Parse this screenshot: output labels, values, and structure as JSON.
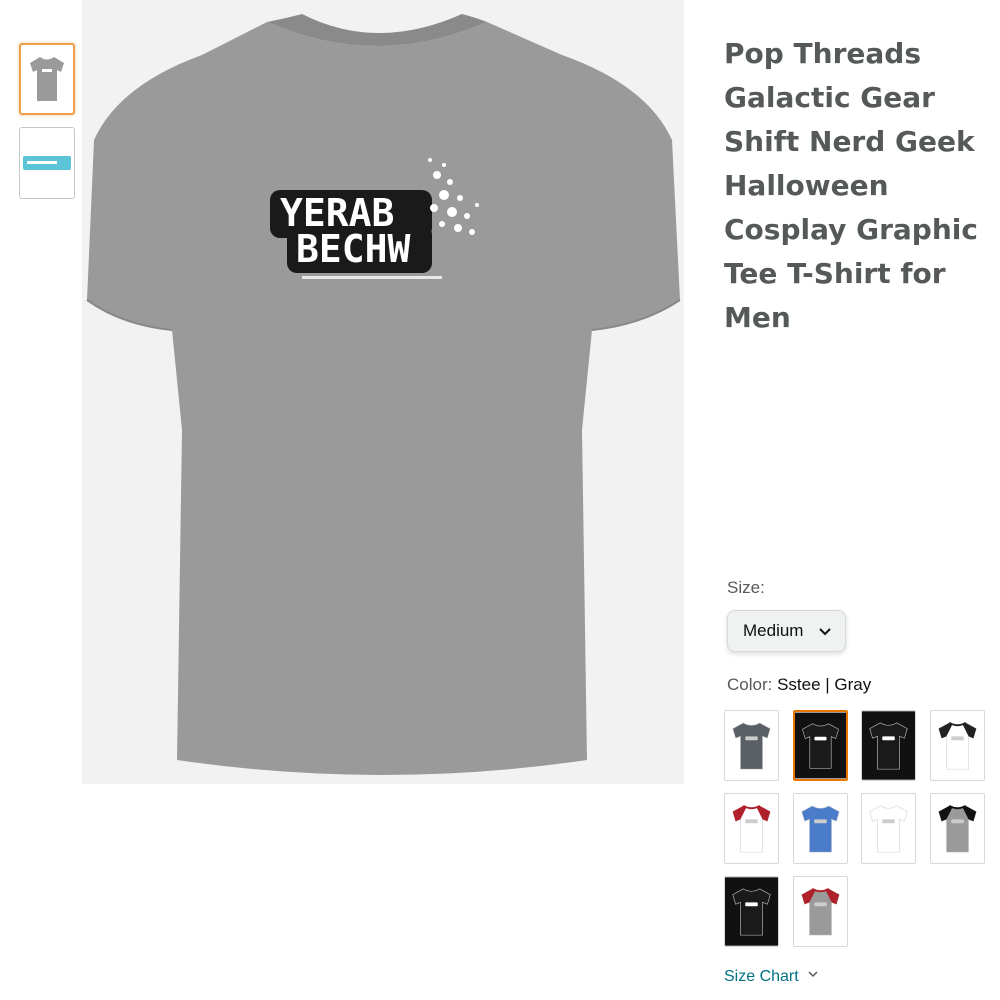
{
  "product": {
    "title": "Pop Threads Galactic Gear Shift Nerd Geek Halloween Cosplay Graphic Tee T-Shirt for Men",
    "print_text_line1": "YERAB",
    "print_text_line2": "BECHW",
    "shirt_color": "#9a9a9a"
  },
  "thumbnails": [
    {
      "name": "gray-shirt-thumbnail",
      "selected": true
    },
    {
      "name": "size-chart-thumbnail",
      "selected": false
    }
  ],
  "size": {
    "label": "Size:",
    "selected": "Medium"
  },
  "color": {
    "label": "Color:",
    "selected": "Sstee | Gray"
  },
  "swatches": [
    {
      "body": "#5b5f66",
      "trim": "#5b5f66",
      "bg": "#ffffff",
      "selected": false
    },
    {
      "body": "#1a1a1a",
      "trim": "#1a1a1a",
      "bg": "#111111",
      "selected": true
    },
    {
      "body": "#1a1a1a",
      "trim": "#1a1a1a",
      "bg": "#111111",
      "selected": false
    },
    {
      "body": "#ffffff",
      "trim": "#222222",
      "bg": "#ffffff",
      "selected": false
    },
    {
      "body": "#ffffff",
      "trim": "#b0202a",
      "bg": "#ffffff",
      "selected": false
    },
    {
      "body": "#4a7cc9",
      "trim": "#4a7cc9",
      "bg": "#ffffff",
      "selected": false
    },
    {
      "body": "#ffffff",
      "trim": "#ffffff",
      "bg": "#ffffff",
      "selected": false
    },
    {
      "body": "#9a9a9a",
      "trim": "#111111",
      "bg": "#ffffff",
      "selected": false
    },
    {
      "body": "#1a1a1a",
      "trim": "#1a1a1a",
      "bg": "#111111",
      "selected": false
    },
    {
      "body": "#9a9a9a",
      "trim": "#b0202a",
      "bg": "#ffffff",
      "selected": false
    }
  ],
  "size_chart": {
    "label": "Size Chart"
  }
}
